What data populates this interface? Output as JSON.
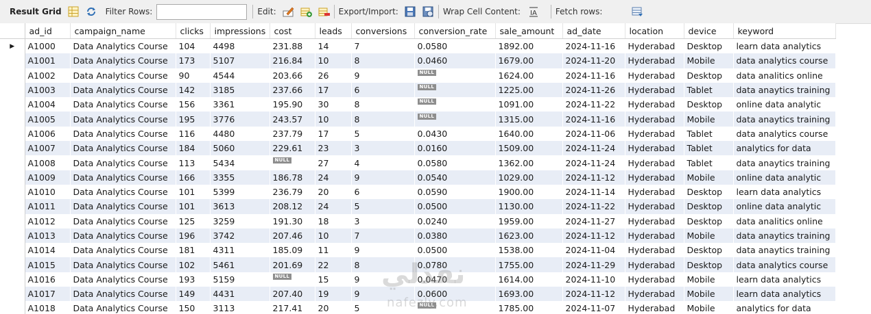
{
  "toolbar": {
    "result_grid_label": "Result Grid",
    "filter_rows_label": "Filter Rows:",
    "filter_rows_value": "",
    "edit_label": "Edit:",
    "export_import_label": "Export/Import:",
    "wrap_cell_label": "Wrap Cell Content:",
    "fetch_rows_label": "Fetch rows:"
  },
  "grid": {
    "columns": [
      "ad_id",
      "campaign_name",
      "clicks",
      "impressions",
      "cost",
      "leads",
      "conversions",
      "conversion_rate",
      "sale_amount",
      "ad_date",
      "location",
      "device",
      "keyword"
    ],
    "null_text": "NULL",
    "selected_row_marker": "▶",
    "rows": [
      [
        "A1000",
        "Data Analytics Course",
        "104",
        "4498",
        "231.88",
        "14",
        "7",
        "0.0580",
        "1892.00",
        "2024-11-16",
        "Hyderabad",
        "Desktop",
        "learn data analytics"
      ],
      [
        "A1001",
        "Data Analytics Course",
        "173",
        "5107",
        "216.84",
        "10",
        "8",
        "0.0460",
        "1679.00",
        "2024-11-20",
        "Hyderabad",
        "Mobile",
        "data analytics course"
      ],
      [
        "A1002",
        "Data Analytics Course",
        "90",
        "4544",
        "203.66",
        "26",
        "9",
        null,
        "1624.00",
        "2024-11-16",
        "Hyderabad",
        "Desktop",
        "data analitics online"
      ],
      [
        "A1003",
        "Data Analytics Course",
        "142",
        "3185",
        "237.66",
        "17",
        "6",
        null,
        "1225.00",
        "2024-11-26",
        "Hyderabad",
        "Tablet",
        "data anaytics training"
      ],
      [
        "A1004",
        "Data Analytics Course",
        "156",
        "3361",
        "195.90",
        "30",
        "8",
        null,
        "1091.00",
        "2024-11-22",
        "Hyderabad",
        "Desktop",
        "online data analytic"
      ],
      [
        "A1005",
        "Data Analytics Course",
        "195",
        "3776",
        "243.57",
        "10",
        "8",
        null,
        "1315.00",
        "2024-11-16",
        "Hyderabad",
        "Mobile",
        "data anaytics training"
      ],
      [
        "A1006",
        "Data Analytics Course",
        "116",
        "4480",
        "237.79",
        "17",
        "5",
        "0.0430",
        "1640.00",
        "2024-11-06",
        "Hyderabad",
        "Tablet",
        "data analytics course"
      ],
      [
        "A1007",
        "Data Analytics Course",
        "184",
        "5060",
        "229.61",
        "23",
        "3",
        "0.0160",
        "1509.00",
        "2024-11-24",
        "Hyderabad",
        "Tablet",
        "analytics for data"
      ],
      [
        "A1008",
        "Data Analytics Course",
        "113",
        "5434",
        null,
        "27",
        "4",
        "0.0580",
        "1362.00",
        "2024-11-24",
        "Hyderabad",
        "Tablet",
        "data anaytics training"
      ],
      [
        "A1009",
        "Data Analytics Course",
        "166",
        "3355",
        "186.78",
        "24",
        "9",
        "0.0540",
        "1029.00",
        "2024-11-12",
        "Hyderabad",
        "Mobile",
        "online data analytic"
      ],
      [
        "A1010",
        "Data Analytics Course",
        "101",
        "5399",
        "236.79",
        "20",
        "6",
        "0.0590",
        "1900.00",
        "2024-11-14",
        "Hyderabad",
        "Desktop",
        "learn data analytics"
      ],
      [
        "A1011",
        "Data Analytics Course",
        "101",
        "3613",
        "208.12",
        "24",
        "5",
        "0.0500",
        "1130.00",
        "2024-11-22",
        "Hyderabad",
        "Desktop",
        "online data analytic"
      ],
      [
        "A1012",
        "Data Analytics Course",
        "125",
        "3259",
        "191.30",
        "18",
        "3",
        "0.0240",
        "1959.00",
        "2024-11-27",
        "Hyderabad",
        "Desktop",
        "data analitics online"
      ],
      [
        "A1013",
        "Data Analytics Course",
        "196",
        "3742",
        "207.46",
        "10",
        "7",
        "0.0380",
        "1623.00",
        "2024-11-12",
        "Hyderabad",
        "Mobile",
        "data anaytics training"
      ],
      [
        "A1014",
        "Data Analytics Course",
        "181",
        "4311",
        "185.09",
        "11",
        "9",
        "0.0500",
        "1538.00",
        "2024-11-04",
        "Hyderabad",
        "Desktop",
        "data anaytics training"
      ],
      [
        "A1015",
        "Data Analytics Course",
        "102",
        "5461",
        "201.69",
        "22",
        "8",
        "0.0780",
        "1755.00",
        "2024-11-29",
        "Hyderabad",
        "Desktop",
        "data analytics course"
      ],
      [
        "A1016",
        "Data Analytics Course",
        "193",
        "5159",
        null,
        "15",
        "9",
        "0.0470",
        "1614.00",
        "2024-11-10",
        "Hyderabad",
        "Mobile",
        "learn data analytics"
      ],
      [
        "A1017",
        "Data Analytics Course",
        "149",
        "4431",
        "207.40",
        "19",
        "9",
        "0.0600",
        "1693.00",
        "2024-11-12",
        "Hyderabad",
        "Mobile",
        "learn data analytics"
      ],
      [
        "A1018",
        "Data Analytics Course",
        "150",
        "3113",
        "217.41",
        "20",
        "5",
        null,
        "1785.00",
        "2024-11-07",
        "Hyderabad",
        "Mobile",
        "analytics for data"
      ]
    ]
  },
  "watermark": {
    "arabic": "نفذلي",
    "latin": "nafezly.com"
  },
  "colors": {
    "row_stripe": "#e8edf6",
    "toolbar_bg": "#f0f0f0",
    "null_badge": "#8e8e8e"
  }
}
